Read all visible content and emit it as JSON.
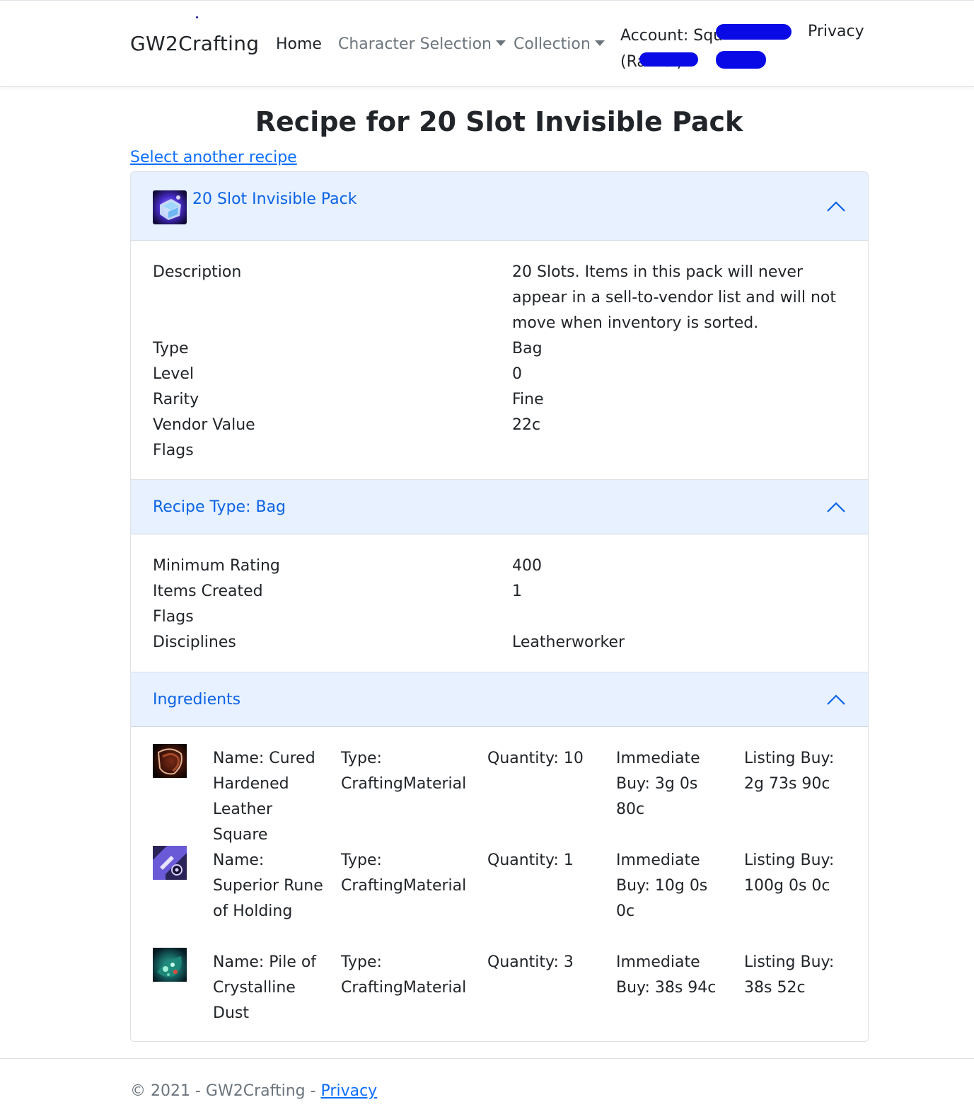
{
  "nav": {
    "brand": "GW2Crafting",
    "home": "Home",
    "character_selection": "Character Selection",
    "collection": "Collection",
    "account_line1": "Account: Squ",
    "account_line2": "(Ra            Be        )",
    "privacy": "Privacy"
  },
  "page": {
    "title": "Recipe for 20 Slot Invisible Pack",
    "select_another": "Select another recipe"
  },
  "item_panel": {
    "title": "20 Slot Invisible Pack",
    "rows": [
      {
        "label": "Description",
        "value": "20 Slots. Items in this pack will never appear in a sell-to-vendor list and will not move when inventory is sorted."
      },
      {
        "label": "Type",
        "value": "Bag"
      },
      {
        "label": "Level",
        "value": "0"
      },
      {
        "label": "Rarity",
        "value": "Fine"
      },
      {
        "label": "Vendor Value",
        "value": "22c"
      },
      {
        "label": "Flags",
        "value": ""
      }
    ]
  },
  "recipe_panel": {
    "title": "Recipe Type: Bag",
    "rows": [
      {
        "label": "Minimum Rating",
        "value": "400"
      },
      {
        "label": "Items Created",
        "value": "1"
      },
      {
        "label": "Flags",
        "value": ""
      },
      {
        "label": "Disciplines",
        "value": "Leatherworker"
      }
    ]
  },
  "ingredients_panel": {
    "title": "Ingredients",
    "items": [
      {
        "name": "Name: Cured Hardened Leather Square",
        "type": "Type: CraftingMaterial",
        "quantity": "Quantity: 10",
        "immediate_buy": "Immediate Buy: 3g 0s 80c",
        "listing_buy": "Listing Buy: 2g 73s 90c"
      },
      {
        "name": "Name: Superior Rune of Holding",
        "type": "Type: CraftingMaterial",
        "quantity": "Quantity: 1",
        "immediate_buy": "Immediate Buy: 10g 0s 0c",
        "listing_buy": "Listing Buy: 100g 0s 0c"
      },
      {
        "name": "Name: Pile of Crystalline Dust",
        "type": "Type: CraftingMaterial",
        "quantity": "Quantity: 3",
        "immediate_buy": "Immediate Buy: 38s 94c",
        "listing_buy": "Listing Buy: 38s 52c"
      }
    ]
  },
  "footer": {
    "text": "© 2021 - GW2Crafting - ",
    "privacy": "Privacy"
  },
  "colors": {
    "accent": "#0d6efd",
    "accordion_header_bg": "#e7f1ff",
    "accordion_header_text": "#0c63e4",
    "redaction": "#0a0ae6"
  }
}
